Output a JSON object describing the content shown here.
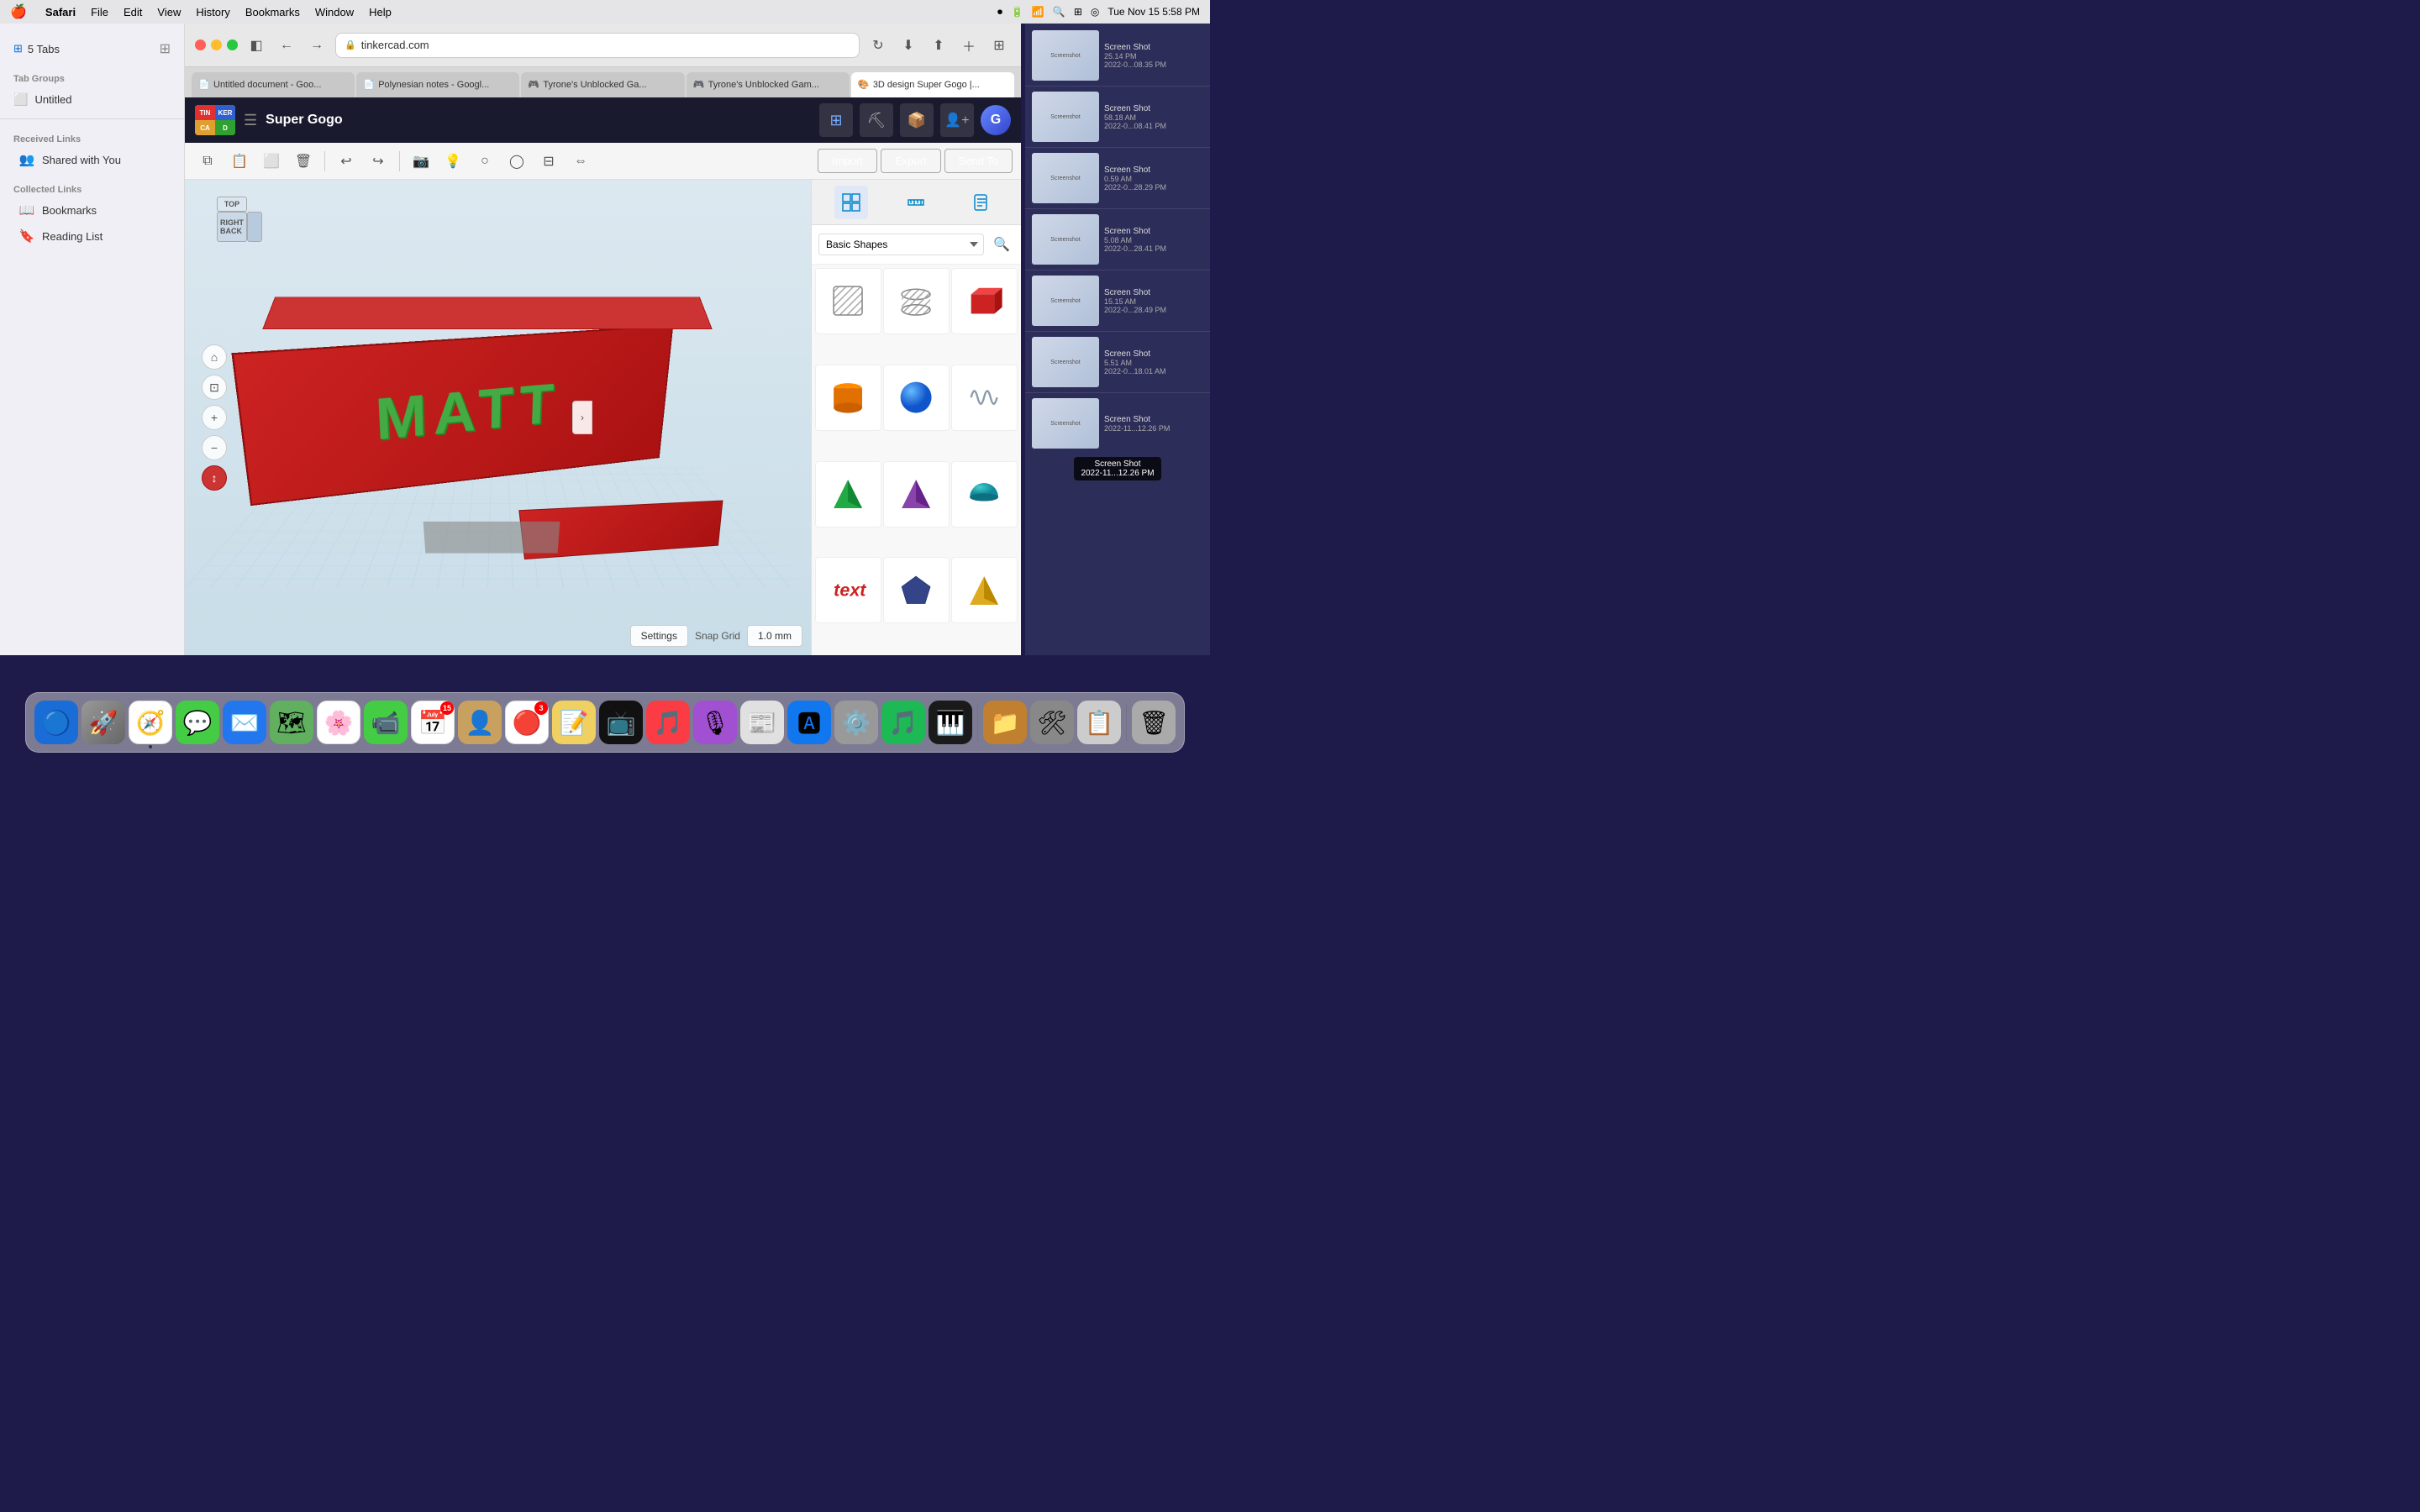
{
  "menubar": {
    "apple": "🍎",
    "app": "Safari",
    "menus": [
      "File",
      "Edit",
      "View",
      "History",
      "Bookmarks",
      "Window",
      "Help"
    ],
    "right": {
      "date": "Tue Nov 15  5:58 PM"
    }
  },
  "browser": {
    "tabs": [
      {
        "label": "Untitled document - Goo...",
        "favicon": "📄",
        "active": false
      },
      {
        "label": "Polynesian notes - Googl...",
        "favicon": "📄",
        "active": false
      },
      {
        "label": "Tyrone's Unblocked Ga...",
        "favicon": "🎮",
        "active": false
      },
      {
        "label": "Tyrone's Unblocked Gam...",
        "favicon": "🎮",
        "active": false
      },
      {
        "label": "3D design Super Gogo |...",
        "favicon": "🎨",
        "active": true
      }
    ],
    "address": "tinkercad.com"
  },
  "tinkercad": {
    "title": "Super Gogo",
    "toolbar_buttons": [
      "copy",
      "paste",
      "duplicate",
      "delete",
      "undo",
      "redo"
    ],
    "import_label": "Import",
    "export_label": "Export",
    "send_to_label": "Send To",
    "snap_grid_label": "Snap Grid",
    "snap_grid_value": "1.0 mm",
    "settings_label": "Settings",
    "shapes_panel_label": "Basic Shapes",
    "shapes_search_placeholder": "Search shapes"
  },
  "sidebar": {
    "tab_groups_label": "Tab Groups",
    "untitled_label": "Untitled",
    "received_links_label": "Received Links",
    "shared_label": "Shared with You",
    "collected_label": "Collected Links",
    "bookmarks_label": "Bookmarks",
    "reading_list_label": "Reading List",
    "tabs_label": "5 Tabs"
  },
  "finder": {
    "items": [
      {
        "name": "Screen Shot",
        "date": "2022-0...08.35 PM",
        "shot_time": "25.14 PM"
      },
      {
        "name": "Screen Shot",
        "date": "2022-0...08.41 PM",
        "shot_time": "58.18 AM"
      },
      {
        "name": "Screen Shot",
        "date": "2022-0...28.29 PM",
        "shot_time": "0.59 AM"
      },
      {
        "name": "Screen Shot",
        "date": "2022-0...28.41 PM",
        "shot_time": "5.08 AM"
      },
      {
        "name": "Screen Shot",
        "date": "2022-0...28.49 PM",
        "shot_time": "15.15 AM"
      },
      {
        "name": "Screen Shot",
        "date": "2022-0...18.01 AM",
        "shot_time": "5.51 AM"
      },
      {
        "name": "Screen Shot",
        "date": "2022-11...12.26 PM",
        "tooltip": true
      }
    ]
  },
  "dock": {
    "icons": [
      {
        "name": "finder",
        "symbol": "🔵",
        "bg": "#0070c9"
      },
      {
        "name": "launchpad",
        "symbol": "🚀",
        "bg": "#888"
      },
      {
        "name": "safari",
        "symbol": "🧭",
        "bg": "#fff"
      },
      {
        "name": "messages",
        "symbol": "💬",
        "bg": "#55cc44"
      },
      {
        "name": "mail",
        "symbol": "✉️",
        "bg": "#2277ee"
      },
      {
        "name": "maps",
        "symbol": "🗺",
        "bg": "#60b060"
      },
      {
        "name": "photos",
        "symbol": "🌸",
        "bg": "#fff"
      },
      {
        "name": "facetime",
        "symbol": "📹",
        "bg": "#44cc44"
      },
      {
        "name": "calendar",
        "symbol": "📅",
        "bg": "#fff",
        "badge": "15"
      },
      {
        "name": "contacts",
        "symbol": "👤",
        "bg": "#c8a060"
      },
      {
        "name": "reminders",
        "symbol": "🔴",
        "bg": "#fff",
        "badge": "3"
      },
      {
        "name": "stickies",
        "symbol": "📝",
        "bg": "#f0d060"
      },
      {
        "name": "appletv",
        "symbol": "📺",
        "bg": "#111"
      },
      {
        "name": "music",
        "symbol": "🎵",
        "bg": "#fc3c44"
      },
      {
        "name": "podcasts",
        "symbol": "🎙",
        "bg": "#a050d0"
      },
      {
        "name": "news",
        "symbol": "📰",
        "bg": "#e0e0e0"
      },
      {
        "name": "appstore",
        "symbol": "🅰",
        "bg": "#1177ee"
      },
      {
        "name": "systemprefs",
        "symbol": "⚙️",
        "bg": "#999"
      },
      {
        "name": "spotify",
        "symbol": "🎵",
        "bg": "#1db954"
      },
      {
        "name": "logicpro",
        "symbol": "🎹",
        "bg": "#1a1a1a"
      },
      {
        "name": "finder2",
        "symbol": "📁",
        "bg": "#c08030"
      },
      {
        "name": "unknown1",
        "symbol": "🛠",
        "bg": "#888"
      },
      {
        "name": "unknown2",
        "symbol": "📋",
        "bg": "#cccccc"
      },
      {
        "name": "trash",
        "symbol": "🗑",
        "bg": "#999"
      }
    ]
  },
  "shapes": [
    {
      "name": "box-hole",
      "color": "#aaa"
    },
    {
      "name": "cylinder-hole",
      "color": "#aaa"
    },
    {
      "name": "box",
      "color": "#cc2222"
    },
    {
      "name": "cylinder",
      "color": "#e08020"
    },
    {
      "name": "sphere",
      "color": "#2288ee"
    },
    {
      "name": "scribble",
      "color": "#8899aa"
    },
    {
      "name": "pyramid-green",
      "color": "#22aa44"
    },
    {
      "name": "pyramid-purple",
      "color": "#8844aa"
    },
    {
      "name": "half-sphere",
      "color": "#2299aa"
    },
    {
      "name": "text-red",
      "color": "#cc2222"
    },
    {
      "name": "pentagon-blue",
      "color": "#334488"
    },
    {
      "name": "pyramid-yellow",
      "color": "#ddaa22"
    }
  ]
}
